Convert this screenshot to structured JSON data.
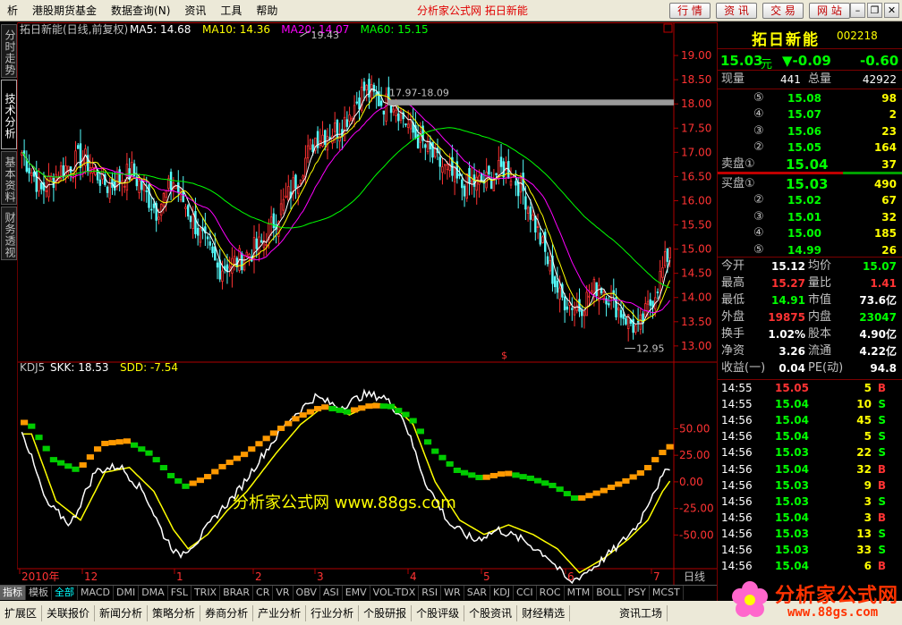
{
  "menu": {
    "items": [
      "析",
      "港股期货基金",
      "数据查询(N)",
      "资讯",
      "工具",
      "帮助"
    ],
    "title": "分析家公式网  拓日新能"
  },
  "topbtns": [
    "行 情",
    "资 讯",
    "交 易",
    "网 站"
  ],
  "side_tabs": [
    "分时走势",
    "技术分析",
    "基本资料",
    "财务透视"
  ],
  "chart_data": [
    {
      "type": "candlestick",
      "title": "拓日新能(日线,前复权)",
      "ma_labels": [
        {
          "name": "MA5",
          "value": "14.68",
          "color": "#ffffff"
        },
        {
          "name": "MA10",
          "value": "14.36",
          "color": "#ffff00"
        },
        {
          "name": "MA20",
          "value": "14.07",
          "color": "#ff00ff"
        },
        {
          "name": "MA60",
          "value": "15.15",
          "color": "#00ff00"
        }
      ],
      "y_ticks": [
        "19.00",
        "18.50",
        "18.00",
        "17.50",
        "17.00",
        "16.50",
        "16.00",
        "15.50",
        "15.00",
        "14.50",
        "14.00",
        "13.50",
        "13.00"
      ],
      "ylim": [
        12.85,
        19.5
      ],
      "x_ticks": [
        "2010年",
        "12",
        "1",
        "2",
        "3",
        "4",
        "5",
        "6",
        "7"
      ],
      "annotations": {
        "high": "19.43",
        "low": "12.95",
        "range": "17.97-18.09"
      },
      "period_label": "日线"
    },
    {
      "type": "line",
      "title": "KDJ5",
      "labels": [
        {
          "name": "SKK",
          "value": "18.53",
          "color": "#ffffff"
        },
        {
          "name": "SDD",
          "value": "-7.54",
          "color": "#ffff00"
        }
      ],
      "y_ticks": [
        "50.00",
        "25.00",
        "0.00",
        "-25.00",
        "-50.00"
      ],
      "ylim": [
        -80,
        100
      ]
    }
  ],
  "watermark": "分析家公式网 www.88gs.com",
  "quote": {
    "name": "拓日新能",
    "code": "002218",
    "price": "15.03",
    "unit": "元",
    "change": "▼-0.09",
    "pct": "-0.60",
    "xianliang_label": "现量",
    "xianliang": "441",
    "zongliang_label": "总量",
    "zongliang": "42922",
    "sell": [
      {
        "lvl": "⑤",
        "price": "15.08",
        "vol": "98"
      },
      {
        "lvl": "④",
        "price": "15.07",
        "vol": "2"
      },
      {
        "lvl": "③",
        "price": "15.06",
        "vol": "23"
      },
      {
        "lvl": "②",
        "price": "15.05",
        "vol": "164"
      },
      {
        "lvl": "卖盘①",
        "price": "15.04",
        "vol": "37"
      }
    ],
    "buy": [
      {
        "lvl": "买盘①",
        "price": "15.03",
        "vol": "490"
      },
      {
        "lvl": "②",
        "price": "15.02",
        "vol": "67"
      },
      {
        "lvl": "③",
        "price": "15.01",
        "vol": "32"
      },
      {
        "lvl": "④",
        "price": "15.00",
        "vol": "185"
      },
      {
        "lvl": "⑤",
        "price": "14.99",
        "vol": "26"
      }
    ],
    "stats": [
      {
        "l1": "今开",
        "v1": "15.12",
        "c1": "#ffffff",
        "l2": "均价",
        "v2": "15.07",
        "c2": "#00ff00"
      },
      {
        "l1": "最高",
        "v1": "15.27",
        "c1": "#ff3333",
        "l2": "量比",
        "v2": "1.41",
        "c2": "#ff3333"
      },
      {
        "l1": "最低",
        "v1": "14.91",
        "c1": "#00ff00",
        "l2": "市值",
        "v2": "73.6亿",
        "c2": "#ffffff"
      },
      {
        "l1": "外盘",
        "v1": "19875",
        "c1": "#ff3333",
        "l2": "内盘",
        "v2": "23047",
        "c2": "#00ff00"
      },
      {
        "l1": "换手",
        "v1": "1.02%",
        "c1": "#ffffff",
        "l2": "股本",
        "v2": "4.90亿",
        "c2": "#ffffff"
      },
      {
        "l1": "净资",
        "v1": "3.26",
        "c1": "#ffffff",
        "l2": "流通",
        "v2": "4.22亿",
        "c2": "#ffffff"
      },
      {
        "l1": "收益(一)",
        "v1": "0.04",
        "c1": "#ffffff",
        "l2": "PE(动)",
        "v2": "94.8",
        "c2": "#ffffff"
      }
    ],
    "ticks": [
      {
        "t": "14:55",
        "p": "15.05",
        "v": "5",
        "s": "B"
      },
      {
        "t": "14:55",
        "p": "15.04",
        "v": "10",
        "s": "S"
      },
      {
        "t": "14:56",
        "p": "15.04",
        "v": "45",
        "s": "S"
      },
      {
        "t": "14:56",
        "p": "15.04",
        "v": "5",
        "s": "S"
      },
      {
        "t": "14:56",
        "p": "15.03",
        "v": "22",
        "s": "S"
      },
      {
        "t": "14:56",
        "p": "15.04",
        "v": "32",
        "s": "B"
      },
      {
        "t": "14:56",
        "p": "15.03",
        "v": "9",
        "s": "B"
      },
      {
        "t": "14:56",
        "p": "15.03",
        "v": "3",
        "s": "S"
      },
      {
        "t": "14:56",
        "p": "15.04",
        "v": "3",
        "s": "B"
      },
      {
        "t": "14:56",
        "p": "15.03",
        "v": "13",
        "s": "S"
      },
      {
        "t": "14:56",
        "p": "15.03",
        "v": "33",
        "s": "S"
      },
      {
        "t": "14:56",
        "p": "15.04",
        "v": "6",
        "s": "B"
      }
    ]
  },
  "indicator_tabs": [
    "指标",
    "模板",
    "全部",
    "MACD",
    "DMI",
    "DMA",
    "FSL",
    "TRIX",
    "BRAR",
    "CR",
    "VR",
    "OBV",
    "ASI",
    "EMV",
    "VOL-TDX",
    "RSI",
    "WR",
    "SAR",
    "KDJ",
    "CCI",
    "ROC",
    "MTM",
    "BOLL",
    "PSY",
    "MCST"
  ],
  "status_tabs": [
    "扩展区",
    "关联报价",
    "新闻分析",
    "策略分析",
    "券商分析",
    "产业分析",
    "行业分析",
    "个股研报",
    "个股评级",
    "个股资讯",
    "财经精选"
  ],
  "status_right": "资讯工场",
  "logo": {
    "text": "分析家公式网",
    "url": "www.88gs.com"
  }
}
